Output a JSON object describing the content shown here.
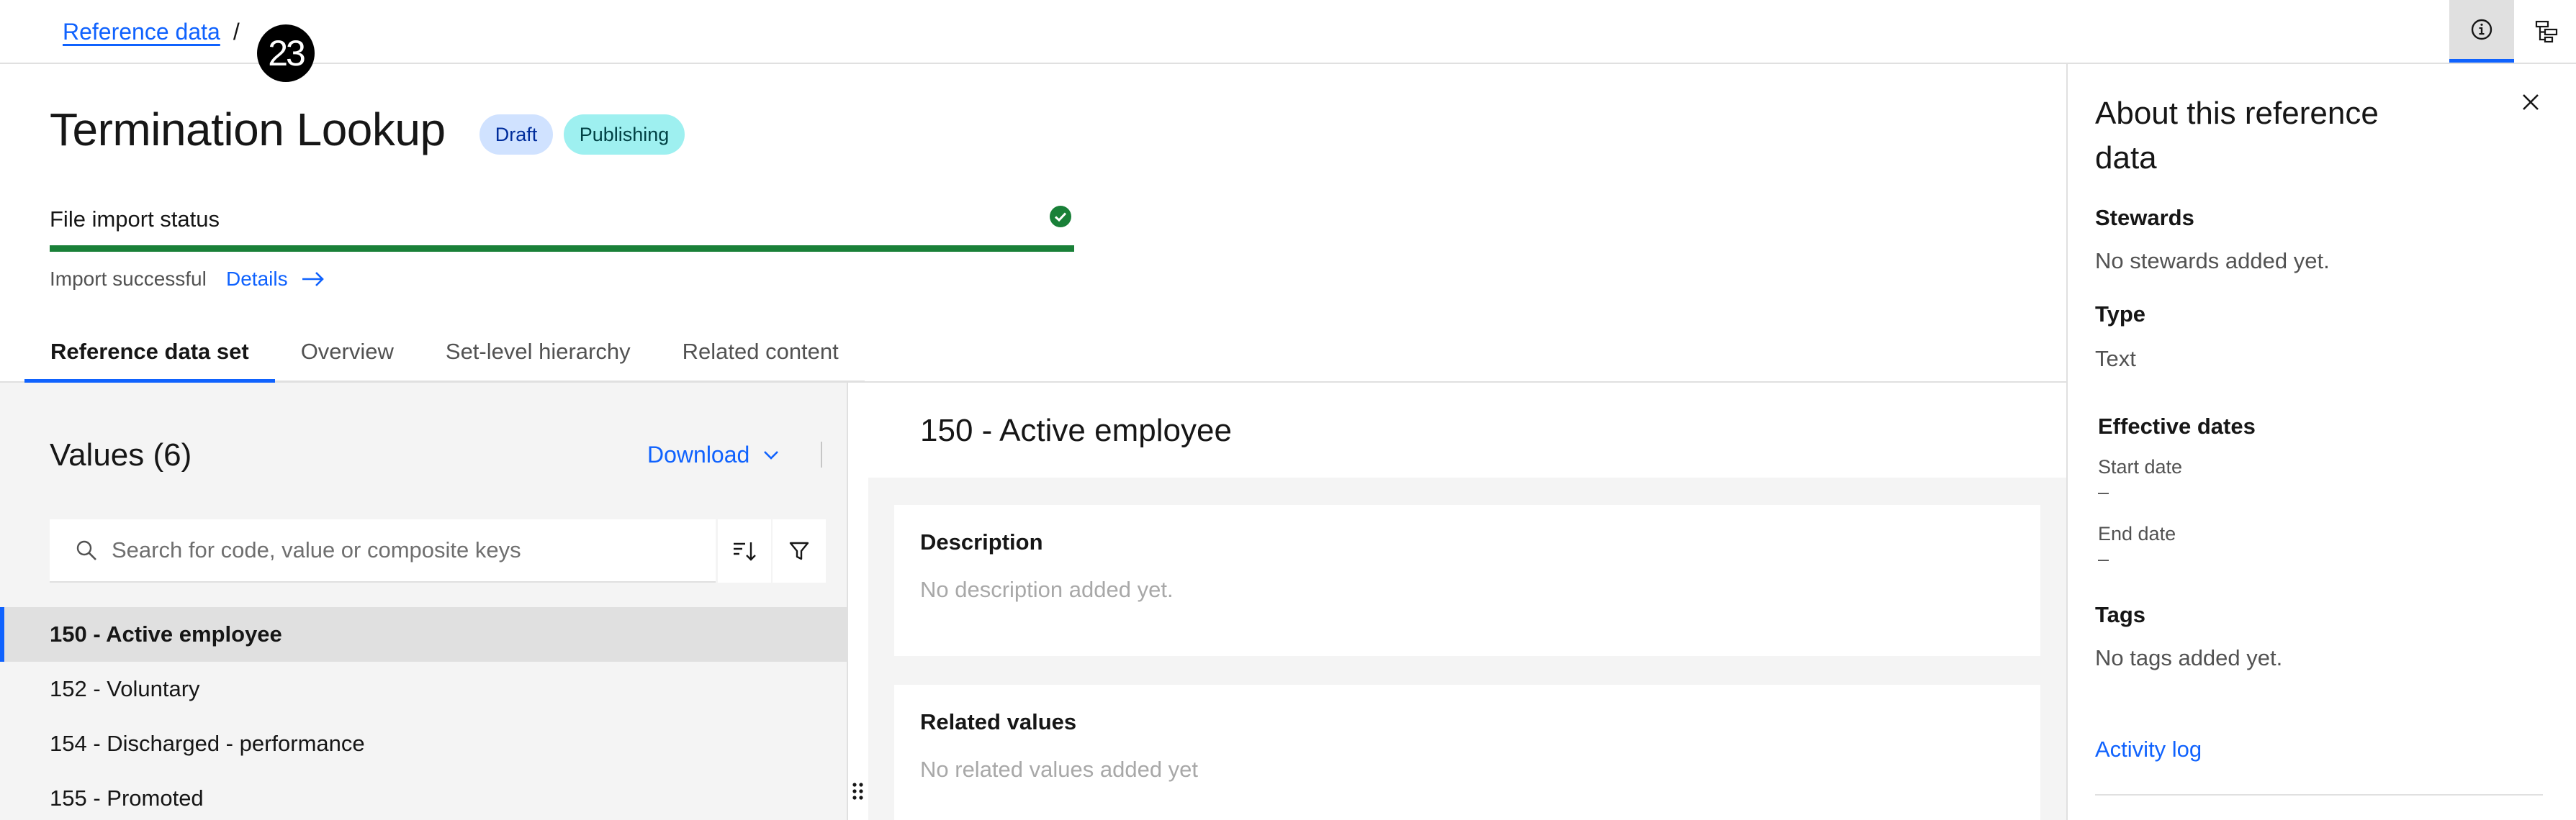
{
  "breadcrumb": {
    "link": "Reference data",
    "separator": "/"
  },
  "overlay_badge": "23",
  "header": {
    "title": "Termination Lookup",
    "tags": {
      "draft": "Draft",
      "publishing": "Publishing"
    }
  },
  "import": {
    "label": "File import status",
    "progress_percent": 100,
    "message": "Import successful",
    "details_link": "Details"
  },
  "tabs": [
    {
      "label": "Reference data set",
      "active": true
    },
    {
      "label": "Overview",
      "active": false
    },
    {
      "label": "Set-level hierarchy",
      "active": false
    },
    {
      "label": "Related content",
      "active": false
    }
  ],
  "values_panel": {
    "title": "Values (6)",
    "download_label": "Download",
    "search_placeholder": "Search for code, value or composite keys",
    "items": [
      {
        "label": "150 - Active employee",
        "selected": true
      },
      {
        "label": "152 - Voluntary",
        "selected": false
      },
      {
        "label": "154 - Discharged - performance",
        "selected": false
      },
      {
        "label": "155 - Promoted",
        "selected": false
      }
    ]
  },
  "detail": {
    "title": "150 - Active employee",
    "description_heading": "Description",
    "description_text": "No description added yet.",
    "related_heading": "Related values",
    "related_text": "No related values added yet"
  },
  "about": {
    "title": "About this reference data",
    "stewards_label": "Stewards",
    "stewards_text": "No stewards added yet.",
    "type_label": "Type",
    "type_value": "Text",
    "effective_dates_label": "Effective dates",
    "start_date_label": "Start date",
    "start_date_value": "–",
    "end_date_label": "End date",
    "end_date_value": "–",
    "tags_label": "Tags",
    "tags_text": "No tags added yet.",
    "activity_log": "Activity log"
  },
  "colors": {
    "accent": "#0f62fe",
    "success": "#198038",
    "draft_tag_bg": "#d0e2ff",
    "publishing_tag_bg": "#9ef0f0"
  },
  "icons": [
    "info-icon",
    "tree-structure-icon",
    "checkmark-filled-icon",
    "arrow-right-icon",
    "chevron-down-icon",
    "search-icon",
    "sort-icon",
    "filter-icon",
    "close-icon",
    "drag-handle-icon"
  ]
}
